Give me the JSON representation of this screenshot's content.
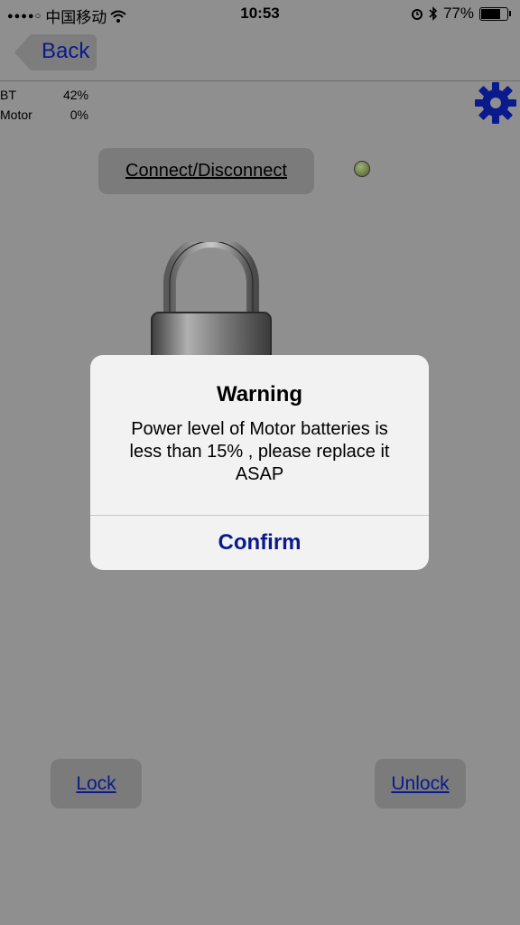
{
  "status_bar": {
    "carrier": "中国移动",
    "time": "10:53",
    "battery_percent": "77%",
    "battery_level": 0.77,
    "icons": [
      "signal-dots-icon",
      "wifi-icon",
      "alarm-icon",
      "bluetooth-icon",
      "battery-icon"
    ]
  },
  "nav": {
    "back_label": "Back"
  },
  "stats": [
    {
      "name": "BT",
      "value": "42%"
    },
    {
      "name": "Motor",
      "value": "0%"
    }
  ],
  "settings": {
    "icon": "gear-icon",
    "color": "#0a1a8c"
  },
  "connect": {
    "label": "Connect/Disconnect",
    "indicator_color": "#6e7f3e"
  },
  "padlock": {
    "icon": "padlock-icon"
  },
  "buttons": {
    "lock_label": "Lock",
    "unlock_label": "Unlock"
  },
  "alert": {
    "title": "Warning",
    "message": "Power level of Motor batteries is less than 15% , please replace it ASAP",
    "confirm_label": "Confirm"
  },
  "colors": {
    "accent": "#0a1a8c",
    "background": "#8f8f8f",
    "alert_bg": "#f2f2f2"
  }
}
